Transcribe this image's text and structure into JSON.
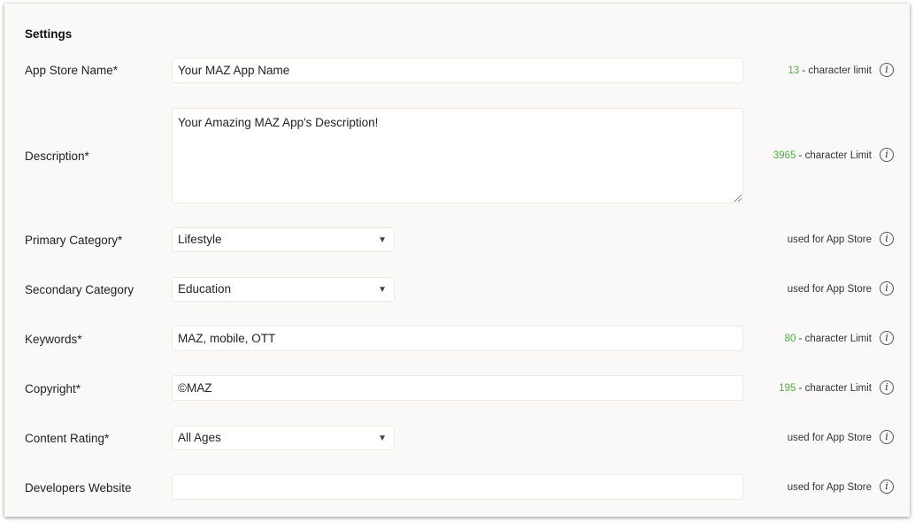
{
  "section_title": "Settings",
  "fields": {
    "app_store_name": {
      "label": "App Store Name*",
      "value": "Your MAZ App Name",
      "hint_count": "13",
      "hint_text": " - character limit"
    },
    "description": {
      "label": "Description*",
      "value": "Your Amazing MAZ App's Description!",
      "hint_count": "3965",
      "hint_text": " - character Limit"
    },
    "primary_category": {
      "label": "Primary Category*",
      "value": "Lifestyle",
      "hint_text": "used for App Store"
    },
    "secondary_category": {
      "label": "Secondary Category",
      "value": "Education",
      "hint_text": "used for App Store"
    },
    "keywords": {
      "label": "Keywords*",
      "value": "MAZ, mobile, OTT",
      "hint_count": "80",
      "hint_text": " - character Limit"
    },
    "copyright": {
      "label": "Copyright*",
      "value": "©MAZ",
      "hint_count": "195",
      "hint_text": " - character Limit"
    },
    "content_rating": {
      "label": "Content Rating*",
      "value": "All Ages",
      "hint_text": "used for App Store"
    },
    "developers_website": {
      "label": "Developers Website",
      "value": "",
      "hint_text": "used for App Store"
    }
  },
  "icons": {
    "info": "info-icon",
    "dropdown": "caret-down-icon"
  },
  "info_glyph": "i",
  "caret_glyph": "▼",
  "colors": {
    "panel_bg": "#faf9f7",
    "field_bg": "#ffffff",
    "count_green": "#4caf3e"
  }
}
